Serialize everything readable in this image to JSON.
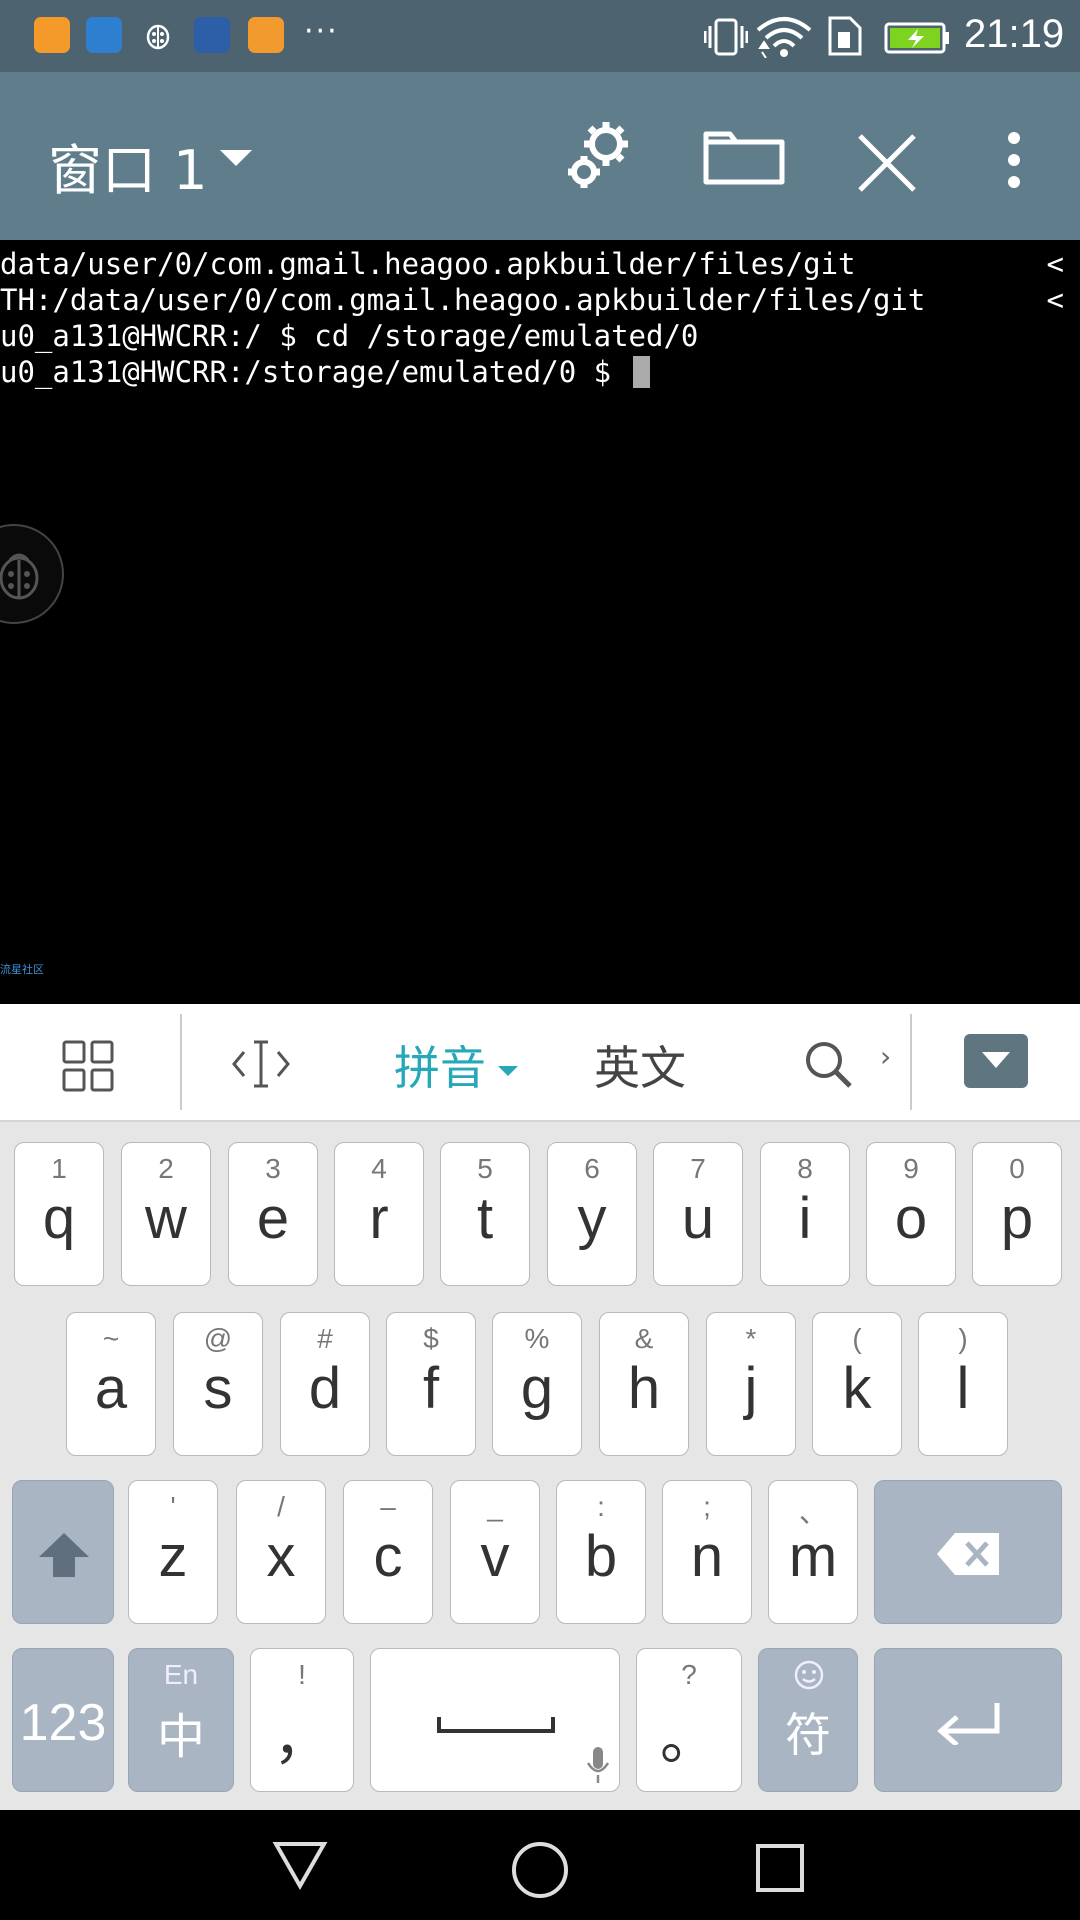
{
  "status_bar": {
    "time": "21:19",
    "app_icons": [
      "uc-browser-icon",
      "contacts-icon",
      "bug-app-icon",
      "ui-app-icon",
      "health-app-icon"
    ],
    "more": "···",
    "icons": [
      "vibrate-icon",
      "wifi-icon",
      "sim-icon",
      "battery-charging-icon"
    ],
    "colors": {
      "background": "#4d6470",
      "battery": "#7ed321"
    }
  },
  "app_bar": {
    "window_title": "窗口 1",
    "actions": [
      "settings-icon",
      "folder-icon",
      "close-icon",
      "overflow-menu-icon"
    ],
    "colors": {
      "background": "#607d8b"
    }
  },
  "terminal": {
    "lines": [
      "data/user/0/com.gmail.heagoo.apkbuilder/files/git",
      "TH:/data/user/0/com.gmail.heagoo.apkbuilder/files/git",
      "u0_a131@HWCRR:/ $ cd /storage/emulated/0",
      "u0_a131@HWCRR:/storage/emulated/0 $ "
    ],
    "truncation_markers": [
      "<",
      "<"
    ],
    "watermark": "流星社区"
  },
  "keyboard_toolbar": {
    "pinyin_label": "拼音",
    "english_label": "英文",
    "chevron": "›",
    "colors": {
      "active": "#26a8b8"
    }
  },
  "keyboard": {
    "row1": [
      {
        "main": "q",
        "sub": "1"
      },
      {
        "main": "w",
        "sub": "2"
      },
      {
        "main": "e",
        "sub": "3"
      },
      {
        "main": "r",
        "sub": "4"
      },
      {
        "main": "t",
        "sub": "5"
      },
      {
        "main": "y",
        "sub": "6"
      },
      {
        "main": "u",
        "sub": "7"
      },
      {
        "main": "i",
        "sub": "8"
      },
      {
        "main": "o",
        "sub": "9"
      },
      {
        "main": "p",
        "sub": "0"
      }
    ],
    "row2": [
      {
        "main": "a",
        "sub": "~"
      },
      {
        "main": "s",
        "sub": "@"
      },
      {
        "main": "d",
        "sub": "#"
      },
      {
        "main": "f",
        "sub": "$"
      },
      {
        "main": "g",
        "sub": "%"
      },
      {
        "main": "h",
        "sub": "&"
      },
      {
        "main": "j",
        "sub": "*"
      },
      {
        "main": "k",
        "sub": "("
      },
      {
        "main": "l",
        "sub": ")"
      }
    ],
    "row3": [
      {
        "main": "z",
        "sub": "'"
      },
      {
        "main": "x",
        "sub": "/"
      },
      {
        "main": "c",
        "sub": "–"
      },
      {
        "main": "v",
        "sub": "_"
      },
      {
        "main": "b",
        "sub": ":"
      },
      {
        "main": "n",
        "sub": ";"
      },
      {
        "main": "m",
        "sub": "、"
      }
    ],
    "numbers_label": "123",
    "lang_main": "中",
    "lang_sub": "En",
    "comma_main": "，",
    "comma_sub": "!",
    "period_main": "。",
    "period_sub": "?",
    "symbols_label": "符",
    "colors": {
      "keyboard_bg": "#e6e6e6",
      "function_key": "#a9b5c2"
    }
  },
  "nav_bar": {
    "icons": [
      "back-icon",
      "home-icon",
      "recents-icon"
    ]
  }
}
